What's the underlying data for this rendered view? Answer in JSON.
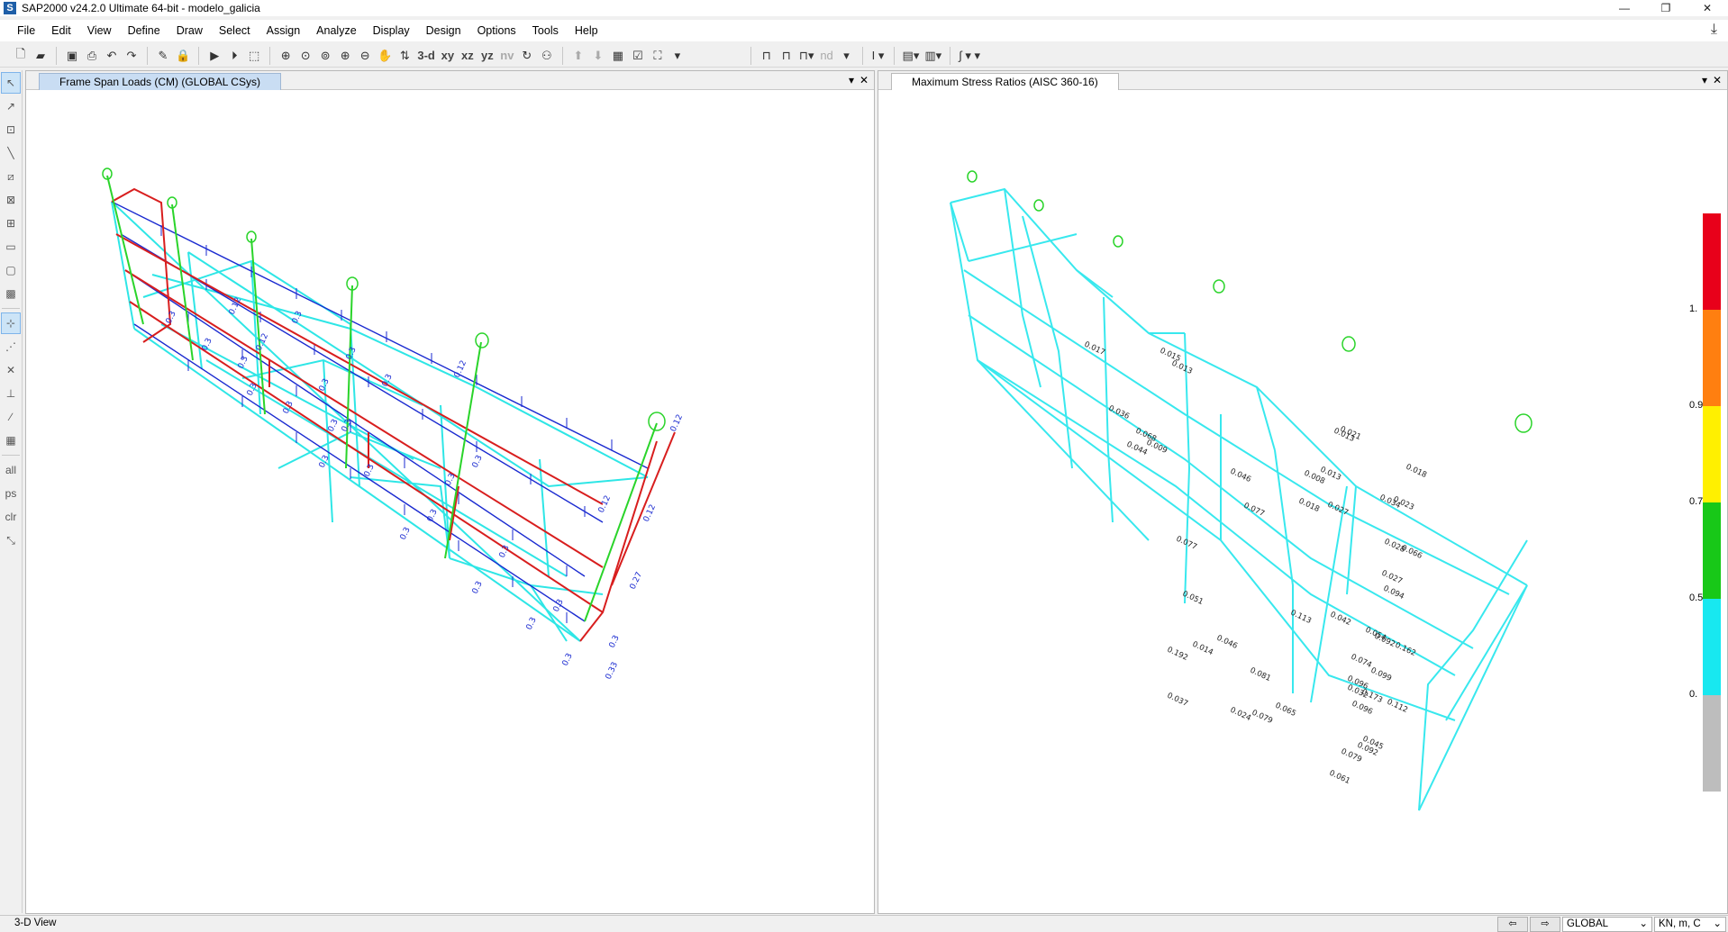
{
  "window": {
    "title": "SAP2000 v24.2.0 Ultimate 64-bit - modelo_galicia",
    "logo": "S",
    "minimize": "—",
    "maximize": "❐",
    "close": "✕"
  },
  "menu": [
    "File",
    "Edit",
    "View",
    "Define",
    "Draw",
    "Select",
    "Assign",
    "Analyze",
    "Display",
    "Design",
    "Options",
    "Tools",
    "Help"
  ],
  "toolbar": {
    "view_3d": "3-d",
    "view_xy": "xy",
    "view_xz": "xz",
    "view_yz": "yz",
    "view_nv": "nv",
    "nd": "nd"
  },
  "left_pane": {
    "tab": "Frame Span Loads (CM) (GLOBAL CSys)",
    "load_labels": [
      "0.12",
      "0.12",
      "0.27",
      "0.3",
      "0.33",
      "0.3",
      "0.3",
      "0.3",
      "0.12",
      "0.12",
      "0.12",
      "0.12",
      "0.3",
      "0.3",
      "0.3",
      "0.3",
      "0.3",
      "0.3",
      "0.3",
      "0.3",
      "0.3",
      "0.3",
      "0.3",
      "0.3",
      "0.3",
      "0.3",
      "0.3",
      "0.3",
      "0.3",
      "0.3",
      "0.3"
    ]
  },
  "right_pane": {
    "tab": "Maximum Stress Ratios  (AISC 360-16)",
    "ratio_labels": [
      "0.066",
      "0.094",
      "0.092",
      "0.096",
      "0.077",
      "0.046",
      "0.068",
      "0.036",
      "0.077",
      "0.046",
      "0.024",
      "0.065",
      "0.032",
      "0.096",
      "0.061",
      "0.013",
      "0.021",
      "0.013",
      "0.027",
      "0.018",
      "0.008",
      "0.034",
      "0.023",
      "0.028",
      "0.027",
      "0.054",
      "0.099",
      "0.173",
      "0.112",
      "0.092",
      "0.162",
      "0.018",
      "0.017",
      "0.015",
      "0.013",
      "0.009",
      "0.044",
      "0.051",
      "0.192",
      "0.014",
      "0.037",
      "0.081",
      "0.079",
      "0.113",
      "0.042",
      "0.074",
      "0.045",
      "0.079"
    ]
  },
  "legend": {
    "labels": [
      "1.",
      "0.9",
      "0.7",
      "0.5",
      "0."
    ],
    "colors": [
      "#e8001a",
      "#ff7f10",
      "#fff000",
      "#18c818",
      "#18e8f0",
      "#bdbdbd"
    ]
  },
  "status": {
    "view": "3-D View",
    "prev": "⇦",
    "next": "⇨",
    "coord_system": "GLOBAL",
    "units": "KN, m, C"
  }
}
